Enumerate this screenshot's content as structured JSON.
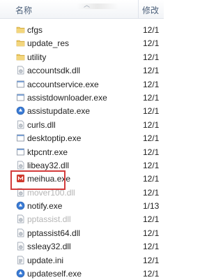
{
  "header": {
    "name_label": "名称",
    "date_label": "修改"
  },
  "files": [
    {
      "name": "cfgs",
      "date": "12/1",
      "icon": "folder-icon"
    },
    {
      "name": "update_res",
      "date": "12/1",
      "icon": "folder-icon"
    },
    {
      "name": "utility",
      "date": "12/1",
      "icon": "folder-icon"
    },
    {
      "name": "accountsdk.dll",
      "date": "12/1",
      "icon": "dll-file-icon"
    },
    {
      "name": "accountservice.exe",
      "date": "12/1",
      "icon": "exe-file-icon"
    },
    {
      "name": "assistdownloader.exe",
      "date": "12/1",
      "icon": "exe-file-icon"
    },
    {
      "name": "assistupdate.exe",
      "date": "12/1",
      "icon": "blue-globe-icon"
    },
    {
      "name": "curls.dll",
      "date": "12/1",
      "icon": "dll-file-icon"
    },
    {
      "name": "desktoptip.exe",
      "date": "12/1",
      "icon": "exe-file-icon"
    },
    {
      "name": "ktpcntr.exe",
      "date": "12/1",
      "icon": "exe-file-icon"
    },
    {
      "name": "libeay32.dll",
      "date": "12/1",
      "icon": "dll-file-icon"
    },
    {
      "name": "meihua.exe",
      "date": "12/1",
      "icon": "red-app-icon"
    },
    {
      "name": "mover100.dll",
      "date": "12/1",
      "icon": "dll-file-icon"
    },
    {
      "name": "notify.exe",
      "date": "1/13",
      "icon": "blue-globe-icon"
    },
    {
      "name": "pptassist.dll",
      "date": "12/1",
      "icon": "dll-file-icon"
    },
    {
      "name": "pptassist64.dll",
      "date": "12/1",
      "icon": "dll-file-icon"
    },
    {
      "name": "ssleay32.dll",
      "date": "12/1",
      "icon": "dll-file-icon"
    },
    {
      "name": "update.ini",
      "date": "12/1",
      "icon": "ini-file-icon"
    },
    {
      "name": "updateself.exe",
      "date": "12/1",
      "icon": "blue-globe-icon"
    }
  ],
  "colors": {
    "highlight_border": "#d33b3b",
    "folder": "#e8c45a",
    "accent_blue": "#3a7bd5"
  }
}
